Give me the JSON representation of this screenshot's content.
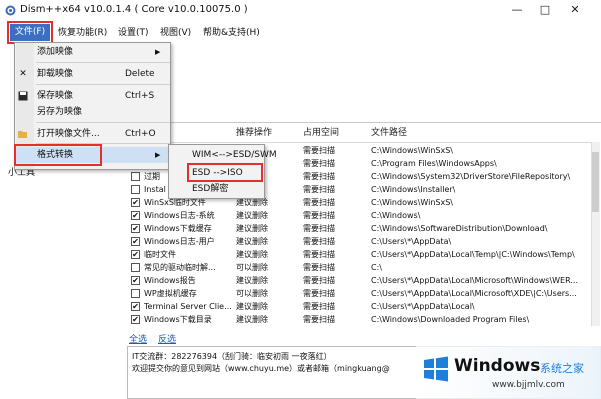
{
  "window": {
    "title": "Dism++x64 v10.0.1.4 ( Core v10.0.10075.0 )",
    "minimize": "—",
    "maximize": "□",
    "close": "✕"
  },
  "menubar": {
    "items": [
      "文件(F)",
      "恢复功能(R)",
      "设置(T)",
      "视图(V)",
      "帮助&支持(H)"
    ]
  },
  "file_menu": {
    "items": [
      {
        "label": "添加映像",
        "shortcut": "",
        "has_submenu": true,
        "icon": ""
      },
      {
        "label": "卸载映像",
        "shortcut": "Delete",
        "has_submenu": false,
        "icon": "close-icon"
      },
      {
        "label": "保存映像",
        "shortcut": "Ctrl+S",
        "has_submenu": false,
        "icon": "save-icon"
      },
      {
        "label": "另存为映像",
        "shortcut": "",
        "has_submenu": false,
        "icon": ""
      },
      {
        "label": "打开映像文件...",
        "shortcut": "Ctrl+O",
        "has_submenu": false,
        "icon": "folder-open-icon"
      },
      {
        "label": "格式转换",
        "shortcut": "",
        "has_submenu": true,
        "icon": ""
      }
    ]
  },
  "format_submenu": {
    "items": [
      "WIM<-->ESD/SWM",
      "ESD  -->ISO",
      "ESD解密"
    ]
  },
  "left_panel": {
    "label": "小工具"
  },
  "table": {
    "columns": [
      "推荐操作",
      "占用空间",
      "文件路径"
    ],
    "rows": [
      {
        "name": "",
        "checked": false,
        "action": "",
        "size": "需要扫描",
        "path": "C:\\Windows\\WinSxS\\"
      },
      {
        "name": "",
        "checked": false,
        "action": "",
        "size": "需要扫描",
        "path": "C:\\Program Files\\WindowsApps\\"
      },
      {
        "name": "过期",
        "checked": false,
        "action": "",
        "size": "需要扫描",
        "path": "C:\\Windows\\System32\\DriverStore\\FileRepository\\"
      },
      {
        "name": "Instal",
        "checked": false,
        "action": "",
        "size": "需要扫描",
        "path": "C:\\Windows\\Installer\\"
      },
      {
        "name": "WinSxS临时文件",
        "checked": true,
        "action": "建议删除",
        "size": "需要扫描",
        "path": "C:\\Windows\\WinSxS\\"
      },
      {
        "name": "Windows日志-系统",
        "checked": true,
        "action": "建议删除",
        "size": "需要扫描",
        "path": "C:\\Windows\\"
      },
      {
        "name": "Windows下载缓存",
        "checked": true,
        "action": "建议删除",
        "size": "需要扫描",
        "path": "C:\\Windows\\SoftwareDistribution\\Download\\"
      },
      {
        "name": "Windows日志-用户",
        "checked": true,
        "action": "建议删除",
        "size": "需要扫描",
        "path": "C:\\Users\\*\\AppData\\"
      },
      {
        "name": "临时文件",
        "checked": true,
        "action": "建议删除",
        "size": "需要扫描",
        "path": "C:\\Users\\*\\AppData\\Local\\Temp\\|C:\\Windows\\Temp\\"
      },
      {
        "name": "常见的驱动临时解...",
        "checked": false,
        "action": "可以删除",
        "size": "需要扫描",
        "path": "C:\\"
      },
      {
        "name": "Windows报告",
        "checked": true,
        "action": "建议删除",
        "size": "需要扫描",
        "path": "C:\\Users\\*\\AppData\\Local\\Microsoft\\Windows\\WER..."
      },
      {
        "name": "WP虚拟机缓存",
        "checked": false,
        "action": "可以删除",
        "size": "需要扫描",
        "path": "C:\\Users\\*\\AppData\\Local\\Microsoft\\XDE\\|C:\\Users..."
      },
      {
        "name": "Terminal Server Clie...",
        "checked": true,
        "action": "建议删除",
        "size": "需要扫描",
        "path": "C:\\Users\\*\\AppData\\Local\\"
      },
      {
        "name": "Windows下载目录",
        "checked": true,
        "action": "建议删除",
        "size": "需要扫描",
        "path": "C:\\Windows\\Downloaded Program Files\\"
      }
    ]
  },
  "bottom_links": {
    "select_all": "全选",
    "invert": "反选"
  },
  "info": {
    "line1": "IT交流群：282276394（刮门骑：临安初雨 一夜落红）",
    "line2": "欢迎提交你的意见到网站（www.chuyu.me）或者邮箱（mingkuang@"
  },
  "watermark": {
    "brand": "Windows",
    "suffix": "系统之家",
    "url": "www.bjjmlv.com"
  },
  "colors": {
    "accent": "#3c6fc2",
    "highlight": "#e0312f",
    "menu_bg": "#f2f2f2"
  }
}
